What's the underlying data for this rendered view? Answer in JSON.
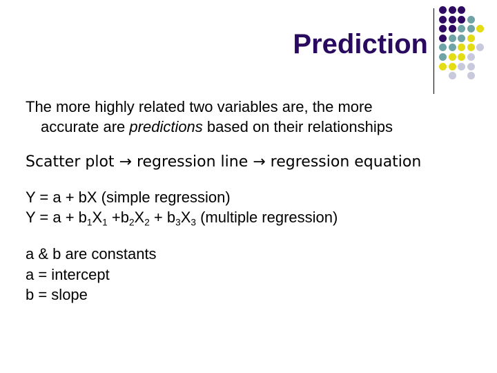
{
  "slide": {
    "title": "Prediction",
    "background_color": "#ffffff",
    "title_color": "#2a0a5e"
  },
  "divider": {
    "color": "#000000"
  },
  "dot_grid": {
    "colors": {
      "purple": "#2f0a62",
      "teal": "#6fa3a5",
      "yellow": "#e4dd15",
      "lavender": "#c9c9de"
    },
    "rows": [
      [
        "purple",
        "purple",
        "purple",
        null,
        null
      ],
      [
        "purple",
        "purple",
        "purple",
        "teal",
        null
      ],
      [
        "purple",
        "purple",
        "teal",
        "teal",
        "yellow"
      ],
      [
        "purple",
        "teal",
        "teal",
        "yellow",
        null
      ],
      [
        "teal",
        "teal",
        "yellow",
        "yellow",
        "lavender"
      ],
      [
        "teal",
        "yellow",
        "yellow",
        "lavender",
        null
      ],
      [
        "yellow",
        "yellow",
        "lavender",
        "lavender",
        null
      ],
      [
        null,
        "lavender",
        null,
        "lavender",
        null
      ]
    ]
  },
  "body": {
    "paragraph_1": {
      "line_1": "The more highly related two variables are, the more",
      "line_2_before": "accurate are ",
      "line_2_italic": "predictions",
      "line_2_after": " based on their relationships"
    },
    "paragraph_2": "Scatter plot → regression line → regression equation",
    "equations": {
      "simple": {
        "prefix": "Y = a + bX (simple regression)"
      },
      "multiple": {
        "p1": "Y = a + b",
        "s1": "1",
        "p2": "X",
        "s2": "1",
        "p3": " +b",
        "s3": "2",
        "p4": "X",
        "s4": "2",
        "p5": " + b",
        "s5": "3",
        "p6": "X",
        "s6": "3",
        "p7": " (multiple regression)"
      }
    },
    "definitions": {
      "line_1": "a & b are constants",
      "line_2": "a = intercept",
      "line_3": "b = slope"
    }
  }
}
